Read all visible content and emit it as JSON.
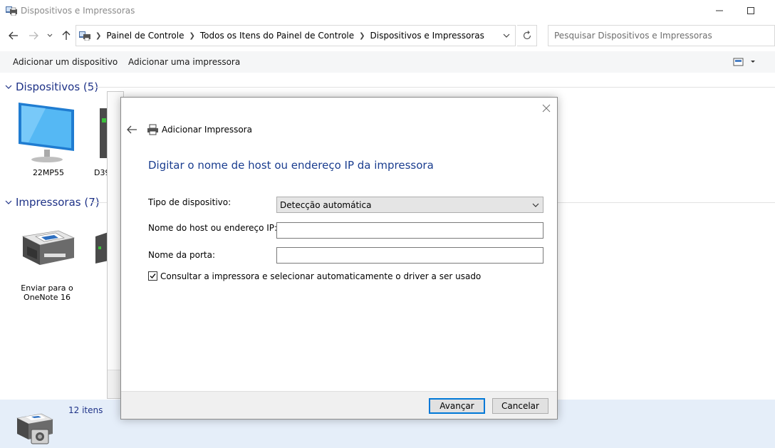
{
  "window": {
    "title": "Dispositivos e Impressoras"
  },
  "nav": {
    "breadcrumbs": [
      "Painel de Controle",
      "Todos os Itens do Painel de Controle",
      "Dispositivos e Impressoras"
    ],
    "search_placeholder": "Pesquisar Dispositivos e Impressoras"
  },
  "commands": {
    "add_device": "Adicionar um dispositivo",
    "add_printer": "Adicionar uma impressora"
  },
  "groups": {
    "devices": {
      "label": "Dispositivos (5)",
      "items": [
        "22MP55",
        "D39"
      ]
    },
    "printers": {
      "label": "Impressoras (7)",
      "items": [
        "Enviar para o OneNote 16"
      ]
    }
  },
  "status": {
    "count": "12 itens"
  },
  "dialog": {
    "title": "Adicionar Impressora",
    "heading": "Digitar o nome de host ou endereço IP da impressora",
    "fields": {
      "device_type_label": "Tipo de dispositivo:",
      "device_type_value": "Detecção automática",
      "host_label": "Nome do host ou endereço IP:",
      "host_value": "",
      "port_label": "Nome da porta:",
      "port_value": ""
    },
    "checkbox_label": "Consultar a impressora e selecionar automaticamente o driver a ser usado",
    "checkbox_checked": true,
    "next_button": "Avançar",
    "cancel_button": "Cancelar"
  },
  "colors": {
    "accent": "#0078d7",
    "group_header": "#1e3287",
    "statusbar_bg": "#e5eef9"
  }
}
